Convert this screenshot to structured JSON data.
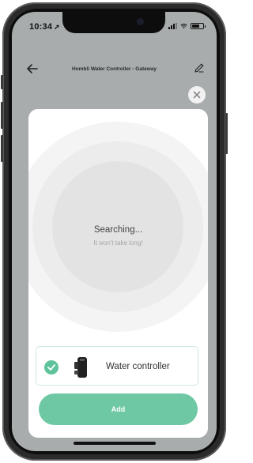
{
  "status_bar": {
    "time": "10:34",
    "location_icon": "location-arrow-icon",
    "signal_icon": "signal-bars-icon",
    "wifi_icon": "wifi-icon",
    "battery_icon": "battery-icon"
  },
  "nav": {
    "title": "Hombli Water Controller - Gateway",
    "back_icon": "back-arrow-icon",
    "edit_icon": "pencil-edit-icon"
  },
  "modal": {
    "close_icon": "close-icon",
    "status_title": "Searching...",
    "status_subtitle": "It won't take long!",
    "device": {
      "name": "Water controller",
      "selected": true,
      "check_icon": "checkmark-icon",
      "device_icon": "water-controller-device-icon"
    },
    "add_label": "Add"
  },
  "colors": {
    "accent": "#6fc8a4",
    "check": "#5ec39a",
    "overlay": "#a9acac"
  }
}
